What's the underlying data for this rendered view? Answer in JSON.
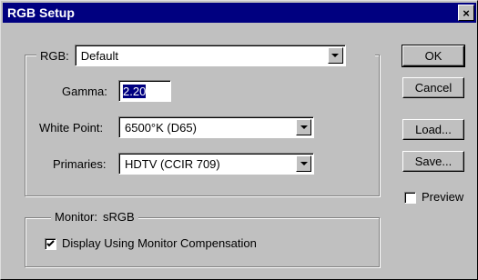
{
  "window": {
    "title": "RGB Setup",
    "close_glyph": "×"
  },
  "rgb_group": {
    "label": "RGB:",
    "value": "Default"
  },
  "gamma": {
    "label": "Gamma:",
    "value": "2.20"
  },
  "white_point": {
    "label": "White Point:",
    "value": "6500°K (D65)"
  },
  "primaries": {
    "label": "Primaries:",
    "value": "HDTV (CCIR 709)"
  },
  "monitor_group": {
    "label": "Monitor:",
    "monitor_name": "sRGB",
    "compensation_label": "Display Using Monitor Compensation",
    "compensation_checked": true
  },
  "buttons": {
    "ok": "OK",
    "cancel": "Cancel",
    "load": "Load...",
    "save": "Save..."
  },
  "preview": {
    "label": "Preview",
    "checked": false
  },
  "colors": {
    "title_bar": "#000080",
    "face": "#c0c0c0",
    "field": "#ffffff"
  }
}
